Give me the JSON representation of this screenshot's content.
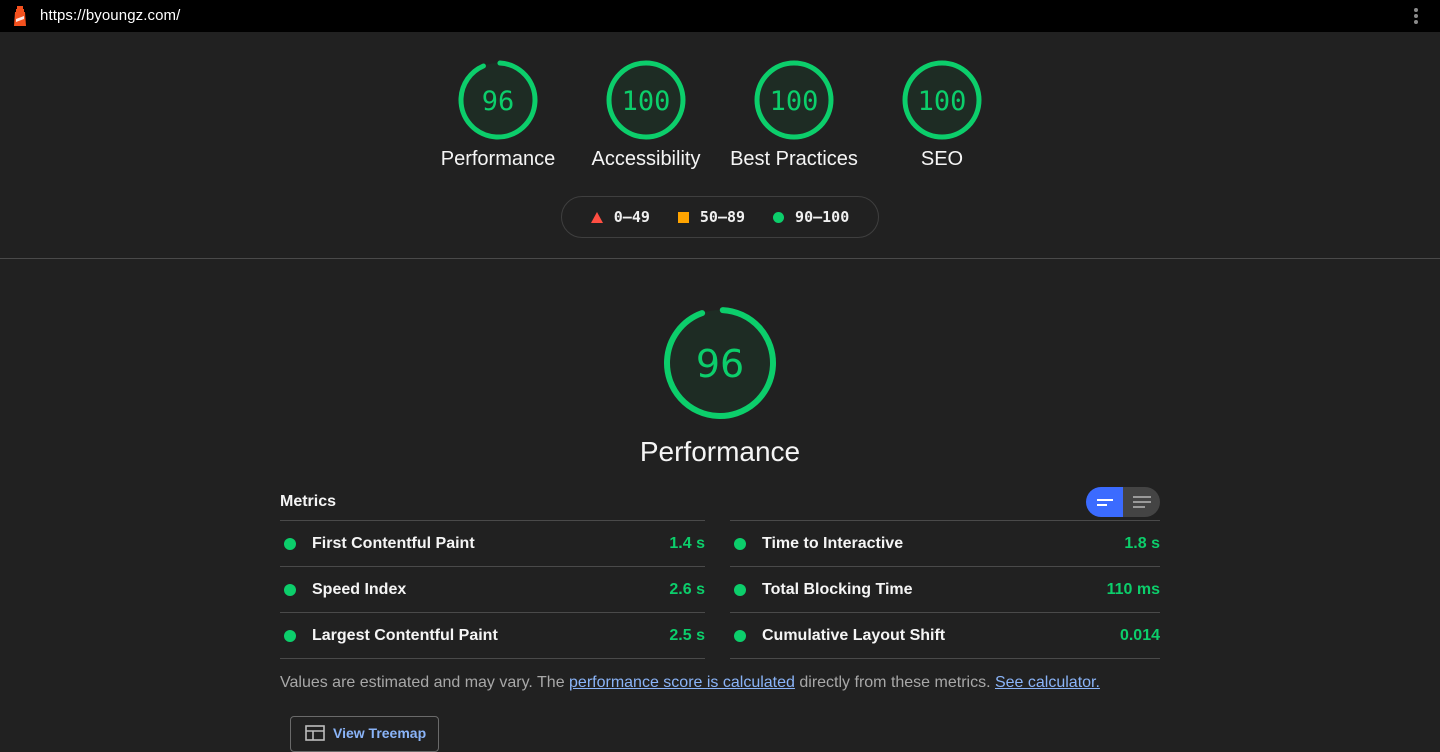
{
  "topbar": {
    "url": "https://byoungz.com/",
    "logo_icon": "lighthouse-icon",
    "menu_icon": "more-vert-icon"
  },
  "colors": {
    "pass": "#0cce6b",
    "average": "#ffa400",
    "fail": "#ff4e42",
    "accent": "#3b6bff",
    "link": "#8ab4f8"
  },
  "categories": [
    {
      "label": "Performance",
      "score": "96",
      "fraction": 0.96
    },
    {
      "label": "Accessibility",
      "score": "100",
      "fraction": 1.0
    },
    {
      "label": "Best Practices",
      "score": "100",
      "fraction": 1.0
    },
    {
      "label": "SEO",
      "score": "100",
      "fraction": 1.0
    }
  ],
  "legend": [
    {
      "shape": "triangle",
      "range": "0–49"
    },
    {
      "shape": "square",
      "range": "50–89"
    },
    {
      "shape": "circle",
      "range": "90–100"
    }
  ],
  "main": {
    "score": "96",
    "fraction": 0.96,
    "title": "Performance"
  },
  "metrics": {
    "title": "Metrics",
    "left": [
      {
        "label": "First Contentful Paint",
        "value": "1.4 s"
      },
      {
        "label": "Speed Index",
        "value": "2.6 s"
      },
      {
        "label": "Largest Contentful Paint",
        "value": "2.5 s"
      }
    ],
    "right": [
      {
        "label": "Time to Interactive",
        "value": "1.8 s"
      },
      {
        "label": "Total Blocking Time",
        "value": "110 ms"
      },
      {
        "label": "Cumulative Layout Shift",
        "value": "0.014"
      }
    ]
  },
  "note": {
    "prefix": "Values are estimated and may vary. The ",
    "link1": "performance score is calculated",
    "middle": " directly from these metrics. ",
    "link2": "See calculator."
  },
  "treemap_button": {
    "label": "View Treemap"
  }
}
